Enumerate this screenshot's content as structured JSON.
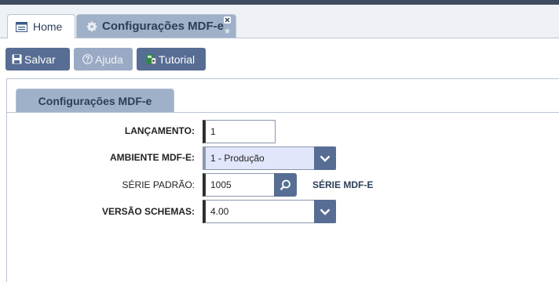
{
  "tabs": [
    {
      "label": "Home",
      "icon": "window-icon"
    },
    {
      "label": "Configurações MDF-e",
      "icon": "gear-icon"
    }
  ],
  "toolbar": {
    "save_label": "Salvar",
    "help_label": "Ajuda",
    "tutorial_label": "Tutorial"
  },
  "section_tab": "Configurações MDF-e",
  "form": {
    "lancamento": {
      "label": "LANÇAMENTO:",
      "value": "1"
    },
    "ambiente": {
      "label": "AMBIENTE MDF-E:",
      "value": "1 - Produção"
    },
    "serie": {
      "label": "SÉRIE PADRÃO:",
      "value": "1005",
      "link": "SÉRIE MDF-E"
    },
    "versao": {
      "label": "VERSÃO SCHEMAS:",
      "value": "4.00"
    }
  },
  "colors": {
    "accent": "#576d93",
    "tab_active": "#9fb0c9",
    "topbar": "#3f4c5e"
  }
}
